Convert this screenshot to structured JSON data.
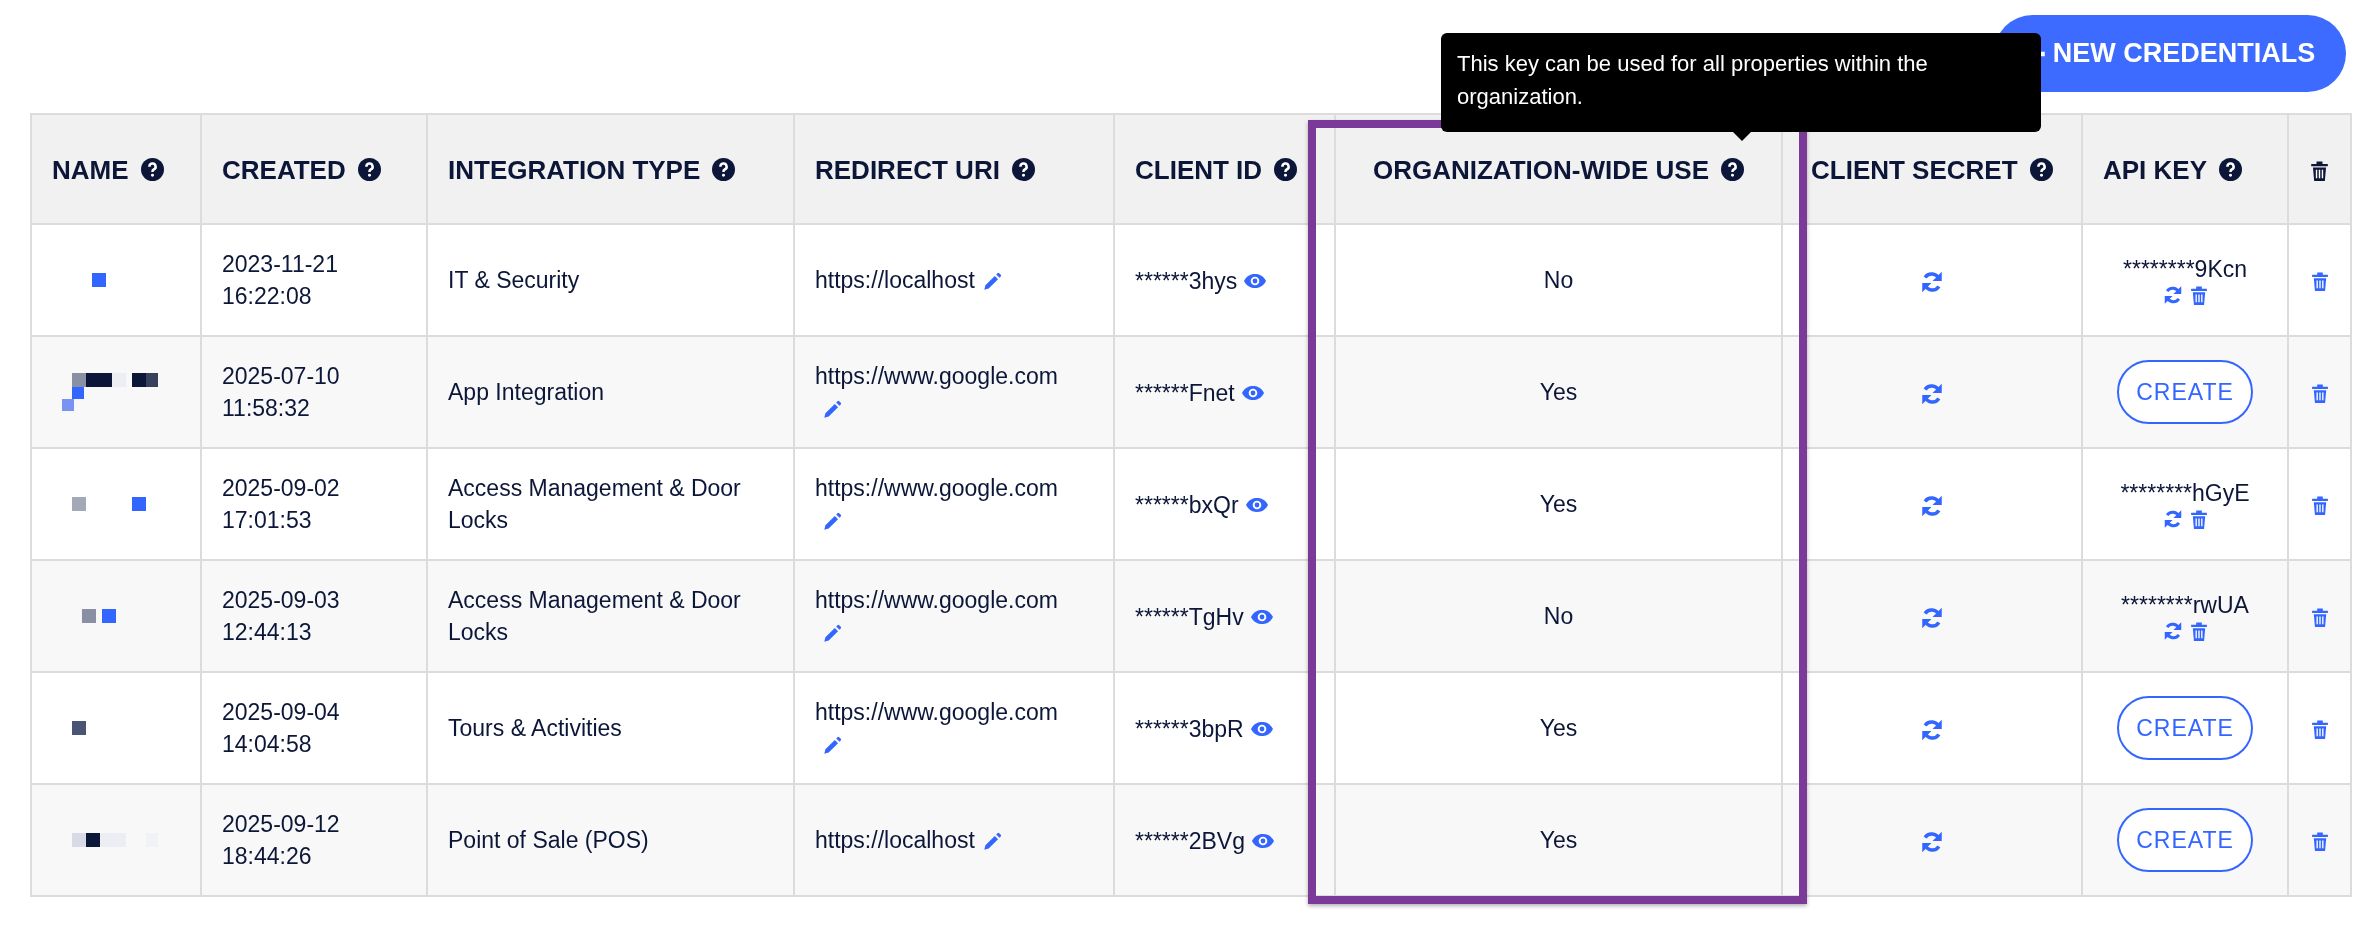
{
  "new_button": {
    "label": "NEW CREDENTIALS"
  },
  "tooltip": {
    "text": "This key can be used for all properties within the organization."
  },
  "table": {
    "columns": [
      {
        "kind": "label",
        "label": "NAME",
        "highlighted": false
      },
      {
        "kind": "label",
        "label": "CREATED",
        "highlighted": false
      },
      {
        "kind": "label",
        "label": "INTEGRATION TYPE",
        "highlighted": false
      },
      {
        "kind": "label",
        "label": "REDIRECT URI",
        "highlighted": false
      },
      {
        "kind": "label",
        "label": "CLIENT ID",
        "highlighted": false
      },
      {
        "kind": "label",
        "label": "ORGANIZATION-WIDE USE",
        "highlighted": true
      },
      {
        "kind": "label",
        "label": "CLIENT SECRET",
        "highlighted": false
      },
      {
        "kind": "label",
        "label": "API KEY",
        "highlighted": false
      },
      {
        "kind": "delete",
        "highlighted": false
      }
    ],
    "rows": [
      {
        "created": "2023-11-21 16:22:08",
        "integration_type": "IT & Security",
        "redirect_uri": "https://localhost",
        "client_id": "******3hys",
        "organization_wide": "No",
        "api_key": {
          "kind": "key",
          "value": "********9Kcn"
        }
      },
      {
        "created": "2025-07-10 11:58:32",
        "integration_type": "App Integration",
        "redirect_uri": "https://www.google.com",
        "client_id": "******Fnet",
        "organization_wide": "Yes",
        "api_key": {
          "kind": "button",
          "label": "CREATE"
        }
      },
      {
        "created": "2025-09-02 17:01:53",
        "integration_type": "Access Management & Door Locks",
        "redirect_uri": "https://www.google.com",
        "client_id": "******bxQr",
        "organization_wide": "Yes",
        "api_key": {
          "kind": "key",
          "value": "********hGyE"
        }
      },
      {
        "created": "2025-09-03 12:44:13",
        "integration_type": "Access Management & Door Locks",
        "redirect_uri": "https://www.google.com",
        "client_id": "******TgHv",
        "organization_wide": "No",
        "api_key": {
          "kind": "key",
          "value": "********rwUA"
        }
      },
      {
        "created": "2025-09-04 14:04:58",
        "integration_type": "Tours & Activities",
        "redirect_uri": "https://www.google.com",
        "client_id": "******3bpR",
        "organization_wide": "Yes",
        "api_key": {
          "kind": "button",
          "label": "CREATE"
        }
      },
      {
        "created": "2025-09-12 18:44:26",
        "integration_type": "Point of Sale (POS)",
        "redirect_uri": "https://localhost",
        "client_id": "******2BVg",
        "organization_wide": "Yes",
        "api_key": {
          "kind": "button",
          "label": "CREATE"
        }
      }
    ]
  }
}
